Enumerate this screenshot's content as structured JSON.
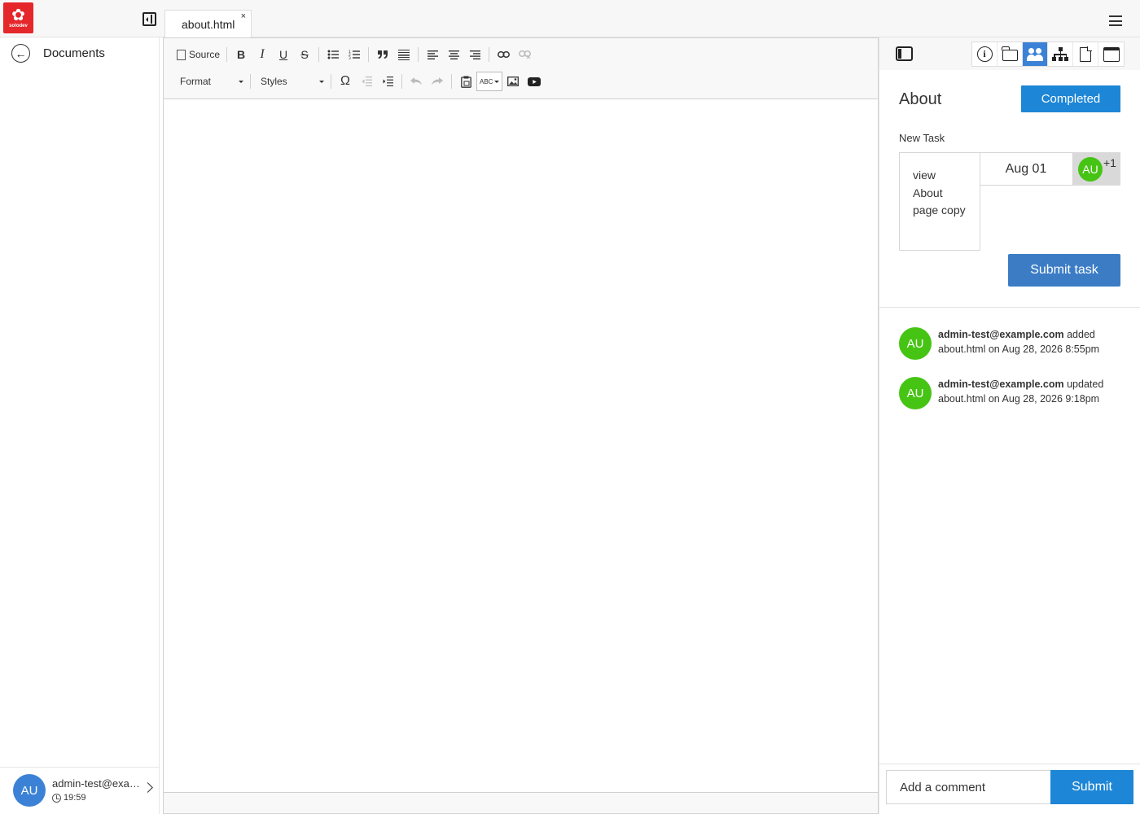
{
  "app": {
    "logo_text": "solodev"
  },
  "tabs": [
    {
      "label": "about.html",
      "close": "×"
    }
  ],
  "sidebar": {
    "back_label": "Documents",
    "user": {
      "initials": "AU",
      "email": "admin-test@example.com",
      "time": "19:59"
    }
  },
  "editor": {
    "toolbar": {
      "source_label": "Source",
      "bold": "B",
      "italic": "I",
      "underline": "U",
      "strike": "S",
      "format_label": "Format",
      "styles_label": "Styles",
      "omega": "Ω",
      "spell": "ABC"
    },
    "content": ""
  },
  "panel": {
    "title": "About",
    "status": "Completed",
    "task_label": "New Task",
    "task_description": "view About page copy",
    "task_due": "Aug 01",
    "assignee_initials": "AU",
    "assignee_more": "+1",
    "submit_task_label": "Submit task",
    "activity": [
      {
        "initials": "AU",
        "user": "admin-test@example.com",
        "action": "added",
        "detail": "about.html on Aug 28, 2026 8:55pm"
      },
      {
        "initials": "AU",
        "user": "admin-test@example.com",
        "action": "updated",
        "detail": "about.html on Aug 28, 2026 9:18pm"
      }
    ],
    "comment_placeholder": "Add a comment",
    "comment_submit_label": "Submit"
  },
  "colors": {
    "brand": "#e5262a",
    "accent": "#1d86d6",
    "task_button": "#3b7cc5",
    "avatar_green": "#46c414",
    "avatar_blue": "#3b82d6"
  }
}
